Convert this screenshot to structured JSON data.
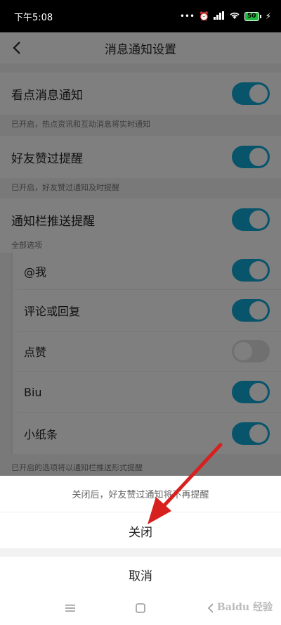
{
  "status_bar": {
    "time": "下午5:08",
    "battery": "50"
  },
  "header": {
    "title": "消息通知设置"
  },
  "settings": {
    "kandian": {
      "label": "看点消息通知",
      "hint": "已开启，热点资讯和互动消息将实时通知",
      "on": true
    },
    "friend_like": {
      "label": "好友赞过提醒",
      "hint": "已开启，好友赞过通知及时提醒",
      "on": true
    },
    "push": {
      "label": "通知栏推送提醒",
      "on": true,
      "all_options_label": "全部选项"
    },
    "options": [
      {
        "label": "@我",
        "on": true
      },
      {
        "label": "评论或回复",
        "on": true
      },
      {
        "label": "点赞",
        "on": false
      },
      {
        "label": "Biu",
        "on": true
      },
      {
        "label": "小纸条",
        "on": true
      }
    ],
    "footer_hint": "已开启的选项将以通知栏推送形式提醒"
  },
  "dialog": {
    "message": "关闭后，好友赞过通知将不再提醒",
    "confirm_label": "关闭",
    "cancel_label": "取消"
  },
  "watermark": "Baidu 经验",
  "colors": {
    "toggle_on": "#0fa9d6",
    "toggle_off": "#e0e0e0",
    "arrow": "#d8201e"
  }
}
